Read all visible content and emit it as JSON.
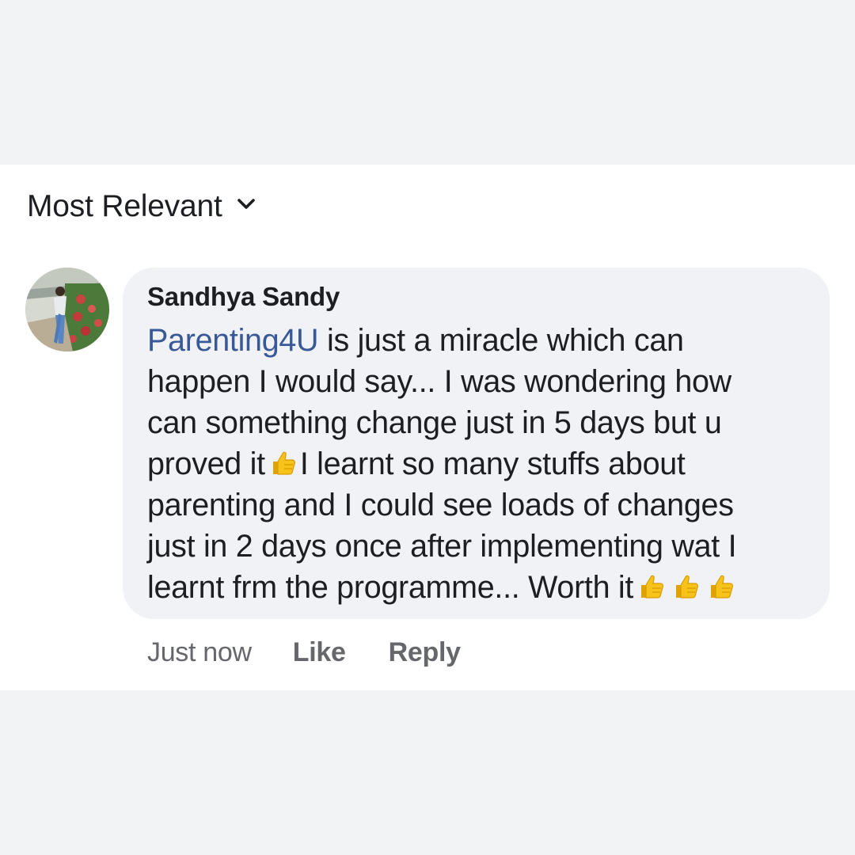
{
  "sort": {
    "label": "Most Relevant",
    "icon": "chevron-down-icon"
  },
  "comment": {
    "author": "Sandhya Sandy",
    "mention": "Parenting4U",
    "text_lines": [
      " is just a miracle which can",
      "happen I would say... I was wondering how",
      "can something change just in 5 days but u",
      "proved it",
      "I learnt so many stuffs about",
      "parenting and I could see loads of changes",
      "just in 2 days once after implementing wat I",
      "learnt frm the programme... Worth it"
    ],
    "emoji": "thumbs-up-icon",
    "timestamp": "Just now",
    "like_label": "Like",
    "reply_label": "Reply"
  },
  "colors": {
    "background": "#f2f3f5",
    "card": "#ffffff",
    "bubble": "#f0f2f5",
    "mention": "#385898",
    "text": "#1c1e21",
    "meta": "#65676b",
    "emoji": "#f7c21a"
  }
}
